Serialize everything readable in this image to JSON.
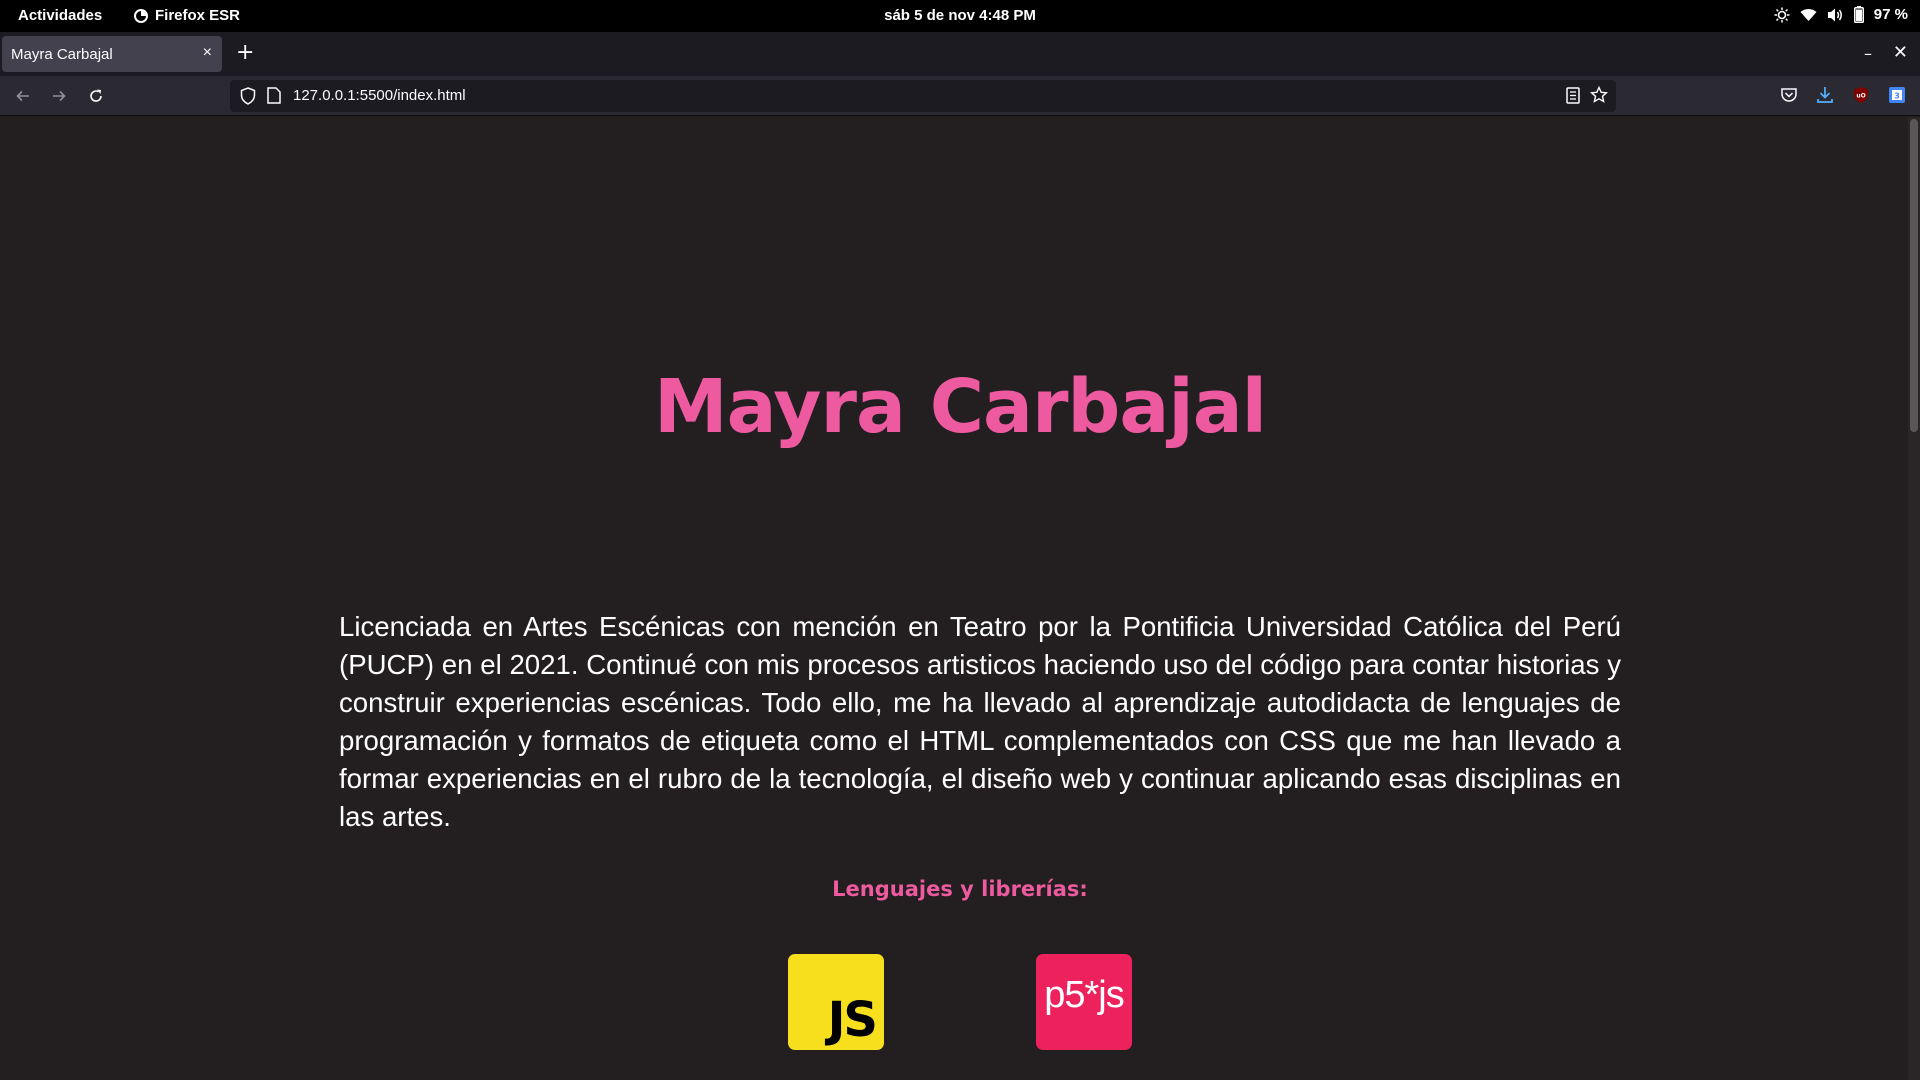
{
  "system_bar": {
    "activities": "Actividades",
    "app_name": "Firefox ESR",
    "clock": "sáb  5 de nov  4:48 PM",
    "battery": "97 %"
  },
  "browser": {
    "tab_title": "Mayra Carbajal",
    "tab_close": "×",
    "new_tab": "+",
    "url": "127.0.0.1:5500/index.html",
    "window_minimize": "–",
    "window_close": "✕"
  },
  "page": {
    "title": "Mayra Carbajal",
    "bio": "Licenciada en Artes Escénicas con mención en Teatro por la Pontificia Universidad Católica del Perú (PUCP) en el 2021. Continué con mis procesos artisticos haciendo uso del código para contar historias y construir experiencias escénicas. Todo ello, me ha llevado al aprendizaje autodidacta de lenguajes de programación y formatos de etiqueta como el HTML complementados con CSS que me han llevado a formar experiencias en el rubro de la tecnología, el diseño web y continuar aplicando esas disciplinas en las artes.",
    "skills_heading": "Lenguajes y librerías:",
    "logos": [
      {
        "label": "JS",
        "color": "#f7df1e"
      },
      {
        "label": "p5*js",
        "color": "#ed225d"
      }
    ]
  },
  "colors": {
    "accent": "#ed5aa0",
    "background": "#231f20"
  }
}
